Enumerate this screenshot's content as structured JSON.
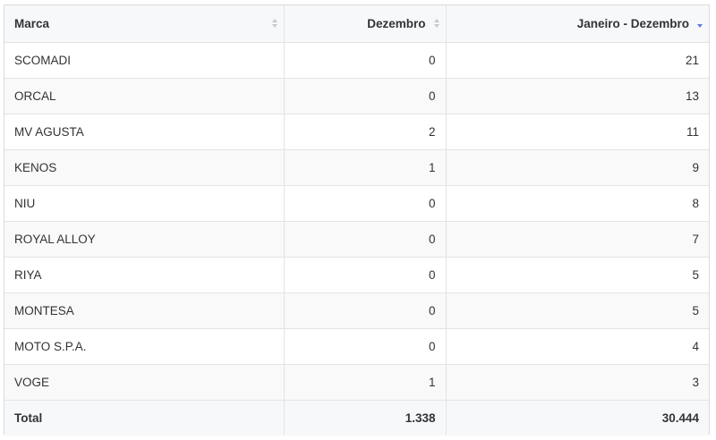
{
  "table": {
    "headers": {
      "brand": "Marca",
      "month": "Dezembro",
      "ytd": "Janeiro - Dezembro"
    },
    "sort": {
      "brand": "none",
      "month": "none",
      "ytd": "descending"
    },
    "colors": {
      "sort_active": "#5b7bd5",
      "sort_inactive": "#c9c9c9"
    },
    "rows": [
      {
        "brand": "SCOMADI",
        "month": "0",
        "ytd": "21"
      },
      {
        "brand": "ORCAL",
        "month": "0",
        "ytd": "13"
      },
      {
        "brand": "MV AGUSTA",
        "month": "2",
        "ytd": "11"
      },
      {
        "brand": "KENOS",
        "month": "1",
        "ytd": "9"
      },
      {
        "brand": "NIU",
        "month": "0",
        "ytd": "8"
      },
      {
        "brand": "ROYAL ALLOY",
        "month": "0",
        "ytd": "7"
      },
      {
        "brand": "RIYA",
        "month": "0",
        "ytd": "5"
      },
      {
        "brand": "MONTESA",
        "month": "0",
        "ytd": "5"
      },
      {
        "brand": "MOTO S.P.A.",
        "month": "0",
        "ytd": "4"
      },
      {
        "brand": "VOGE",
        "month": "1",
        "ytd": "3"
      }
    ],
    "total": {
      "label": "Total",
      "month": "1.338",
      "ytd": "30.444"
    }
  }
}
